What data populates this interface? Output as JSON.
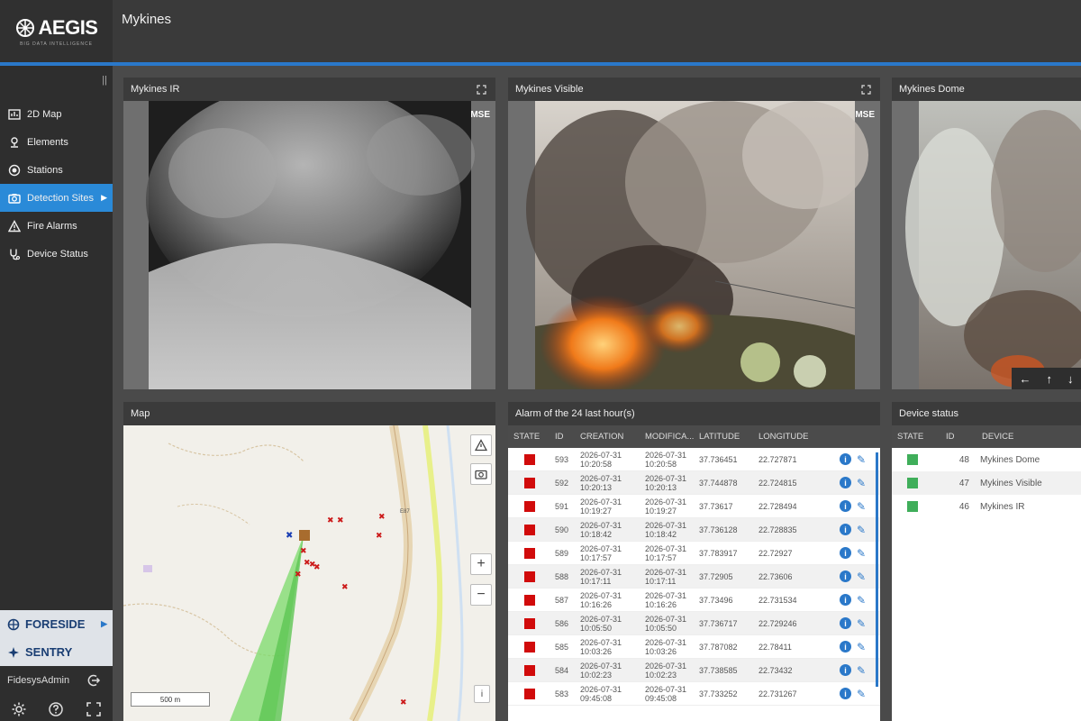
{
  "header": {
    "logo_text": "AEGIS",
    "logo_sub": "BIG DATA INTELLIGENCE",
    "site_title": "Mykines"
  },
  "sidebar": {
    "collapse": "||",
    "items": [
      {
        "label": "2D Map",
        "icon": "map-icon"
      },
      {
        "label": "Elements",
        "icon": "location-pin-icon"
      },
      {
        "label": "Stations",
        "icon": "target-icon"
      },
      {
        "label": "Detection Sites",
        "icon": "camera-icon",
        "active": true
      },
      {
        "label": "Fire Alarms",
        "icon": "warning-icon"
      },
      {
        "label": "Device Status",
        "icon": "stethoscope-icon"
      }
    ],
    "brands": [
      {
        "label": "FORESIDE"
      },
      {
        "label": "SENTRY"
      }
    ],
    "user": "FidesysAdmin"
  },
  "cameras": [
    {
      "title": "Mykines IR",
      "overlay": "MSE"
    },
    {
      "title": "Mykines Visible",
      "overlay": "MSE"
    },
    {
      "title": "Mykines Dome"
    }
  ],
  "map": {
    "title": "Map",
    "scale_label": "500 m",
    "road_label": "E87"
  },
  "alarms": {
    "title": "Alarm of the 24 last hour(s)",
    "columns": [
      "STATE",
      "ID",
      "CREATION",
      "MODIFICA...",
      "LATITUDE",
      "LONGITUDE"
    ],
    "rows": [
      {
        "id": "593",
        "created_date": "2026-07-31",
        "created_time": "10:20:58",
        "modified_date": "2026-07-31",
        "modified_time": "10:20:58",
        "lat": "37.736451",
        "lon": "22.727871"
      },
      {
        "id": "592",
        "created_date": "2026-07-31",
        "created_time": "10:20:13",
        "modified_date": "2026-07-31",
        "modified_time": "10:20:13",
        "lat": "37.744878",
        "lon": "22.724815"
      },
      {
        "id": "591",
        "created_date": "2026-07-31",
        "created_time": "10:19:27",
        "modified_date": "2026-07-31",
        "modified_time": "10:19:27",
        "lat": "37.73617",
        "lon": "22.728494"
      },
      {
        "id": "590",
        "created_date": "2026-07-31",
        "created_time": "10:18:42",
        "modified_date": "2026-07-31",
        "modified_time": "10:18:42",
        "lat": "37.736128",
        "lon": "22.728835"
      },
      {
        "id": "589",
        "created_date": "2026-07-31",
        "created_time": "10:17:57",
        "modified_date": "2026-07-31",
        "modified_time": "10:17:57",
        "lat": "37.783917",
        "lon": "22.72927"
      },
      {
        "id": "588",
        "created_date": "2026-07-31",
        "created_time": "10:17:11",
        "modified_date": "2026-07-31",
        "modified_time": "10:17:11",
        "lat": "37.72905",
        "lon": "22.73606"
      },
      {
        "id": "587",
        "created_date": "2026-07-31",
        "created_time": "10:16:26",
        "modified_date": "2026-07-31",
        "modified_time": "10:16:26",
        "lat": "37.73496",
        "lon": "22.731534"
      },
      {
        "id": "586",
        "created_date": "2026-07-31",
        "created_time": "10:05:50",
        "modified_date": "2026-07-31",
        "modified_time": "10:05:50",
        "lat": "37.736717",
        "lon": "22.729246"
      },
      {
        "id": "585",
        "created_date": "2026-07-31",
        "created_time": "10:03:26",
        "modified_date": "2026-07-31",
        "modified_time": "10:03:26",
        "lat": "37.787082",
        "lon": "22.78411"
      },
      {
        "id": "584",
        "created_date": "2026-07-31",
        "created_time": "10:02:23",
        "modified_date": "2026-07-31",
        "modified_time": "10:02:23",
        "lat": "37.738585",
        "lon": "22.73432"
      },
      {
        "id": "583",
        "created_date": "2026-07-31",
        "created_time": "09:45:08",
        "modified_date": "2026-07-31",
        "modified_time": "09:45:08",
        "lat": "37.733252",
        "lon": "22.731267"
      }
    ]
  },
  "devices": {
    "title": "Device status",
    "columns": [
      "STATE",
      "ID",
      "DEVICE"
    ],
    "rows": [
      {
        "id": "48",
        "name": "Mykines Dome"
      },
      {
        "id": "47",
        "name": "Mykines Visible"
      },
      {
        "id": "46",
        "name": "Mykines IR"
      }
    ]
  },
  "colors": {
    "accent": "#2a78c9",
    "alarm_state": "#d10b0b",
    "device_ok": "#3fae5a",
    "brand_text": "#1a3e73"
  }
}
